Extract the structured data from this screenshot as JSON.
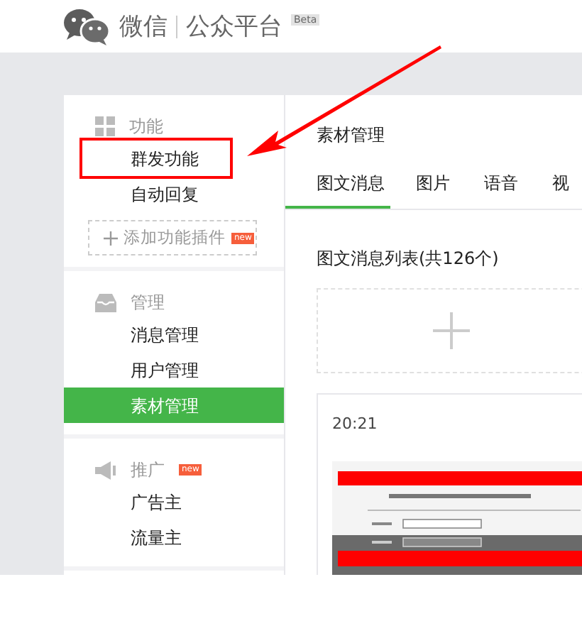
{
  "header": {
    "brand": "微信",
    "product": "公众平台",
    "badge": "Beta"
  },
  "sidebar": {
    "sections": [
      {
        "kind": "grid",
        "title": "功能",
        "items": [
          {
            "label": "群发功能",
            "selected": false
          },
          {
            "label": "自动回复",
            "selected": false
          }
        ],
        "action": {
          "label": "添加功能插件",
          "badge": "new"
        }
      },
      {
        "kind": "inbox",
        "title": "管理",
        "items": [
          {
            "label": "消息管理",
            "selected": false
          },
          {
            "label": "用户管理",
            "selected": false
          },
          {
            "label": "素材管理",
            "selected": true
          }
        ]
      },
      {
        "kind": "megaphone",
        "title": "推广",
        "badge": "new",
        "items": [
          {
            "label": "广告主",
            "selected": false
          },
          {
            "label": "流量主",
            "selected": false
          }
        ]
      }
    ]
  },
  "main": {
    "title": "素材管理",
    "tabs": [
      {
        "label": "图文消息",
        "selected": true
      },
      {
        "label": "图片",
        "selected": false
      },
      {
        "label": "语音",
        "selected": false
      },
      {
        "label": "视",
        "selected": false
      }
    ],
    "list_title": "图文消息列表(共126个)",
    "articles": [
      {
        "time": "20:21"
      }
    ]
  }
}
